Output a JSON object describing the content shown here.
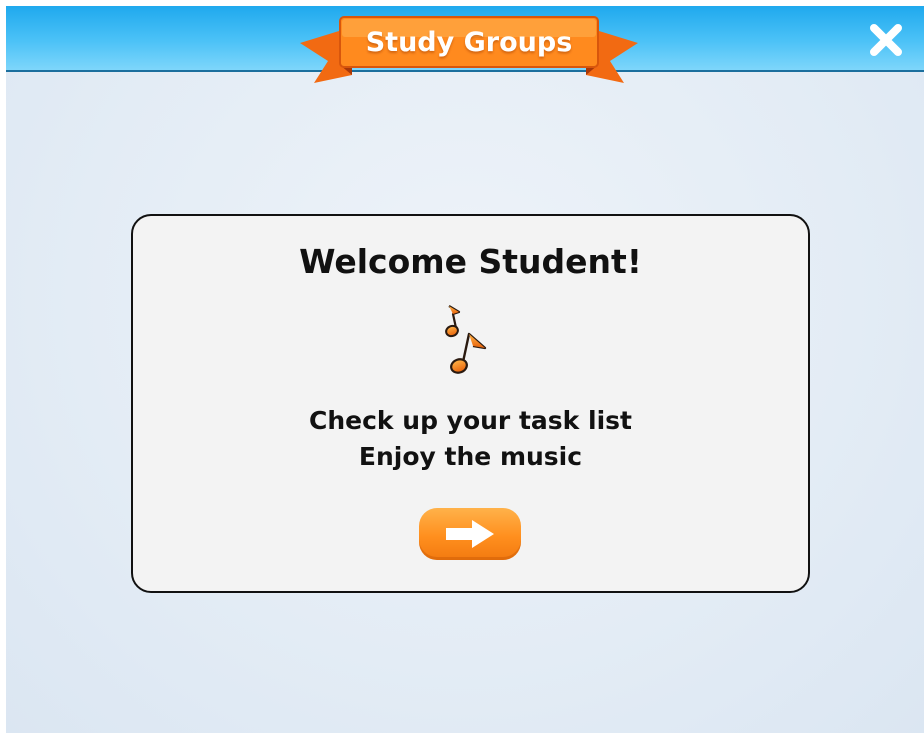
{
  "header": {
    "title": "Study Groups",
    "close_icon": "close-icon"
  },
  "dialog": {
    "title": "Welcome Student!",
    "icon": "music-notes-icon",
    "lines": [
      "Check up your task list",
      "Enjoy the music"
    ],
    "next_icon": "arrow-right-icon"
  },
  "colors": {
    "header_blue": "#2aaef0",
    "ribbon_orange": "#ff7a12",
    "button_orange": "#ff9526",
    "card_background": "#f3f3f3"
  }
}
